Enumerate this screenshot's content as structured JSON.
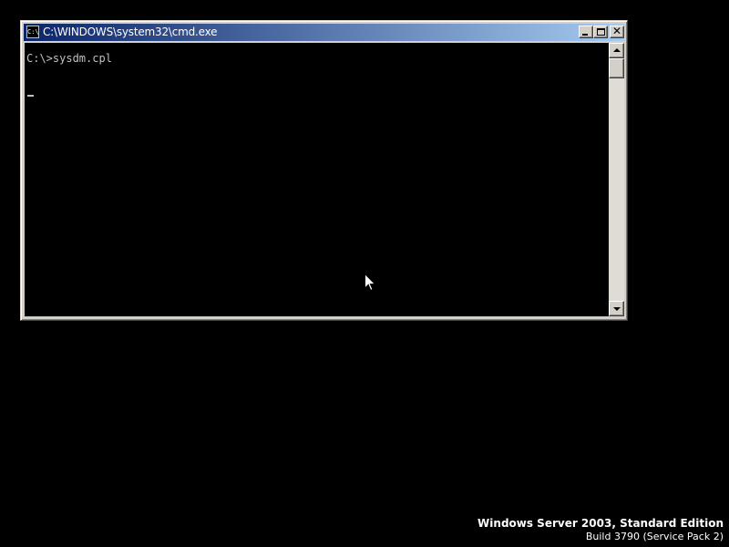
{
  "window": {
    "title": "C:\\WINDOWS\\system32\\cmd.exe",
    "icon": "console-icon",
    "icon_glyph": "C:\\",
    "buttons": {
      "minimize": "minimize-icon",
      "maximize": "maximize-icon",
      "close": "close-icon",
      "close_glyph": "✕"
    }
  },
  "console": {
    "lines": [
      "C:\\>sysdm.cpl"
    ],
    "text_color": "#c0c0c0",
    "background": "#000000"
  },
  "desktop": {
    "edition": "Windows Server 2003, Standard Edition",
    "build": "Build 3790 (Service Pack 2)"
  },
  "colors": {
    "titlebar_start": "#0a246a",
    "titlebar_end": "#a6caf0",
    "chrome": "#d4d0c8"
  }
}
